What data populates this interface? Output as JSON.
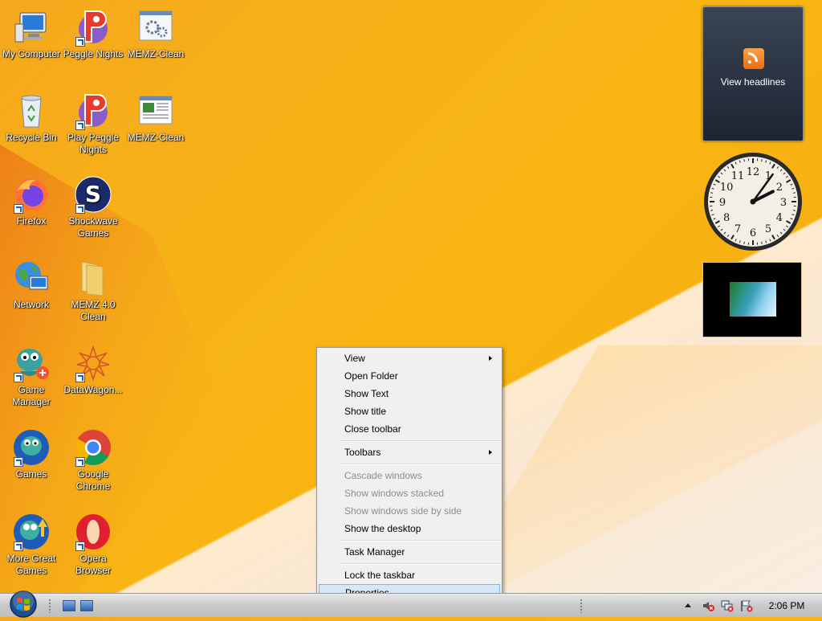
{
  "desktop": {
    "icons": [
      {
        "label": "My Computer",
        "icon": "my-computer-icon"
      },
      {
        "label": "Peggle Nights",
        "icon": "peggle-icon"
      },
      {
        "label": "MEMZ-Clean",
        "icon": "gear-settings-icon"
      },
      {
        "label": "Recycle Bin",
        "icon": "recycle-bin-icon"
      },
      {
        "label": "Play Peggle Nights",
        "icon": "peggle-icon"
      },
      {
        "label": "MEMZ-Clean",
        "icon": "document-window-icon"
      },
      {
        "label": "Firefox",
        "icon": "firefox-icon"
      },
      {
        "label": "Shockwave Games",
        "icon": "shockwave-icon"
      },
      {
        "label": "Network",
        "icon": "network-globe-icon"
      },
      {
        "label": "MEMZ 4.0 Clean",
        "icon": "folder-icon"
      },
      {
        "label": "Game Manager",
        "icon": "game-manager-icon"
      },
      {
        "label": "DataWagon...",
        "icon": "datawagon-icon"
      },
      {
        "label": "Games",
        "icon": "games-icon"
      },
      {
        "label": "Google Chrome",
        "icon": "chrome-icon"
      },
      {
        "label": "More Great Games",
        "icon": "more-games-icon"
      },
      {
        "label": "Opera Browser",
        "icon": "opera-icon"
      }
    ]
  },
  "gadgets": {
    "news_label": "View headlines",
    "clock_numbers": [
      "12",
      "1",
      "2",
      "3",
      "4",
      "5",
      "6",
      "7",
      "8",
      "9",
      "10",
      "11"
    ],
    "clock_time": {
      "hour": 2,
      "minute": 6
    }
  },
  "context_menu": {
    "items": [
      {
        "label": "View",
        "submenu": true,
        "enabled": true
      },
      {
        "label": "Open Folder",
        "enabled": true
      },
      {
        "label": "Show Text",
        "enabled": true
      },
      {
        "label": "Show title",
        "enabled": true
      },
      {
        "label": "Close toolbar",
        "enabled": true
      },
      {
        "label": "Toolbars",
        "submenu": true,
        "enabled": true
      },
      {
        "label": "Cascade windows",
        "enabled": false
      },
      {
        "label": "Show windows stacked",
        "enabled": false
      },
      {
        "label": "Show windows side by side",
        "enabled": false
      },
      {
        "label": "Show the desktop",
        "enabled": true
      },
      {
        "label": "Task Manager",
        "enabled": true
      },
      {
        "label": "Lock the taskbar",
        "enabled": true
      },
      {
        "label": "Properties",
        "enabled": true,
        "highlighted": true
      }
    ]
  },
  "taskbar": {
    "clock": "2:06 PM",
    "tray_icons": [
      "volume-muted-icon",
      "network-error-icon",
      "action-center-flag-icon"
    ]
  },
  "colors": {
    "accent_highlight": "#d5e7f9",
    "disabled_text": "#8d8d8d",
    "menu_bg": "#f0f0f0"
  }
}
